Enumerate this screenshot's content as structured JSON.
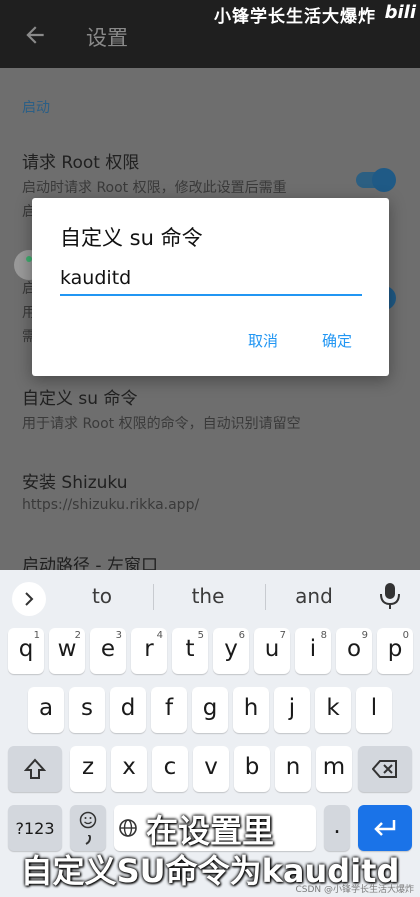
{
  "watermark": {
    "text": "小锋学长生活大爆炸",
    "logo": "bili"
  },
  "appbar": {
    "title": "设置",
    "back_icon": "arrow-left-icon"
  },
  "settings": {
    "section": "启动",
    "request_root": {
      "title": "请求 Root 权限",
      "summary": "启动时请求 Root 权限，修改此设置后需重",
      "summary_cont": "启"
    },
    "hidden_item": {
      "frag1": "启",
      "frag2": "用",
      "frag3": "需"
    },
    "custom_su": {
      "title": "自定义 su 命令",
      "summary": "用于请求 Root 权限的命令，自动识别请留空"
    },
    "shizuku": {
      "title": "安装 Shizuku",
      "summary": "https://shizuku.rikka.app/"
    },
    "start_path": {
      "title": "启动路径 - 左窗口"
    }
  },
  "dialog": {
    "title": "自定义 su 命令",
    "input_value": "kauditd",
    "cancel": "取消",
    "ok": "确定"
  },
  "keyboard": {
    "suggestions": [
      "to",
      "the",
      "and"
    ],
    "row1": [
      {
        "ch": "q",
        "num": "1"
      },
      {
        "ch": "w",
        "num": "2"
      },
      {
        "ch": "e",
        "num": "3"
      },
      {
        "ch": "r",
        "num": "4"
      },
      {
        "ch": "t",
        "num": "5"
      },
      {
        "ch": "y",
        "num": "6"
      },
      {
        "ch": "u",
        "num": "7"
      },
      {
        "ch": "i",
        "num": "8"
      },
      {
        "ch": "o",
        "num": "9"
      },
      {
        "ch": "p",
        "num": "0"
      }
    ],
    "row2": [
      "a",
      "s",
      "d",
      "f",
      "g",
      "h",
      "j",
      "k",
      "l"
    ],
    "row3": [
      "z",
      "x",
      "c",
      "v",
      "b",
      "n",
      "m"
    ],
    "sym_label": "?123",
    "period": ".",
    "colors": {
      "enter": "#1a73e8",
      "accent": "#2196f3"
    }
  },
  "captions": {
    "line1": "在设置里",
    "line2": "自定义SU命令为kauditd"
  },
  "credit": "CSDN @小锋学长生活大爆炸"
}
